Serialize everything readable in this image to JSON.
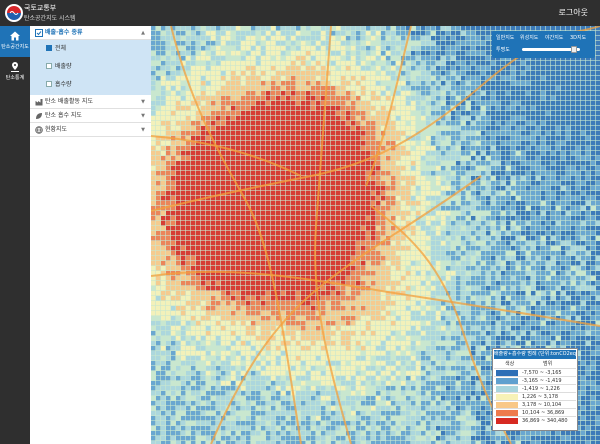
{
  "header": {
    "brand_line1": "국토교통부",
    "brand_line2": "탄소공간지도 시스템",
    "logout": "로그아웃"
  },
  "rail": {
    "items": [
      {
        "label": "탄소공간지도",
        "icon": "home-icon",
        "active": true
      },
      {
        "label": "탄소통계",
        "icon": "map-pin-icon",
        "active": false
      }
    ]
  },
  "panel": {
    "sections": [
      {
        "label": "배출·흡수 종류",
        "icon": "check-square-icon",
        "open": true,
        "options": [
          {
            "label": "전체",
            "checked": true
          },
          {
            "label": "배출량",
            "checked": false
          },
          {
            "label": "흡수량",
            "checked": false
          }
        ]
      },
      {
        "label": "탄소 배출활동 지도",
        "icon": "factory-icon",
        "open": false
      },
      {
        "label": "탄소 흡수 지도",
        "icon": "leaf-icon",
        "open": false
      },
      {
        "label": "현황지도",
        "icon": "globe-icon",
        "open": false
      }
    ]
  },
  "map_tools": {
    "buttons": [
      "일반지도",
      "위성지도",
      "야간지도",
      "3D지도"
    ],
    "opacity_label": "투명도",
    "opacity_value": 0.95
  },
  "legend": {
    "title": "배출량+흡수량 범례 (단위:tonCO2eq)",
    "col_color": "색상",
    "col_range": "범위",
    "rows": [
      {
        "range": "-7,570 ~ -3,165",
        "color": "#2d6fb6"
      },
      {
        "range": "-3,165 ~ -1,419",
        "color": "#5fa0cf"
      },
      {
        "range": "-1,419 ~ 1,226",
        "color": "#a8d5de"
      },
      {
        "range": "1,226 ~ 3,178",
        "color": "#f7f2b7"
      },
      {
        "range": "3,178 ~ 10,104",
        "color": "#f9c887"
      },
      {
        "range": "10,104 ~ 36,869",
        "color": "#ee7a4c"
      },
      {
        "range": "36,869 ~ 340,480",
        "color": "#d72a22"
      }
    ]
  },
  "map": {
    "background": "#c9e7cf",
    "road_color": "#f3a03c"
  }
}
